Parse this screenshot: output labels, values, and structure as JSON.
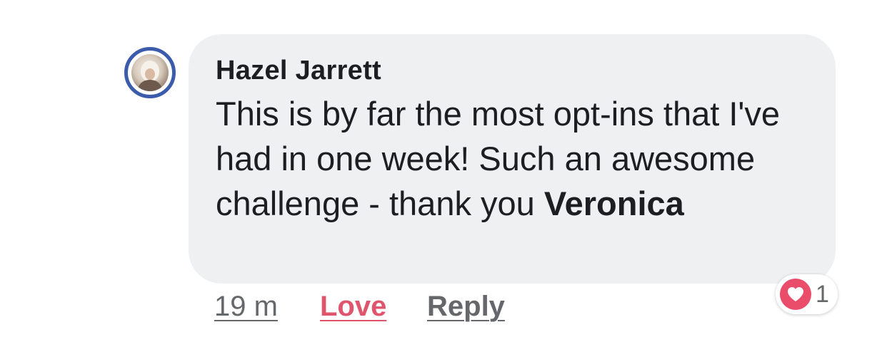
{
  "comment": {
    "author": "Hazel Jarrett",
    "text_before_mention": "This is by far the most opt-ins that I've had in one week! Such an awesome challenge - thank you ",
    "mention": "Veronica"
  },
  "actions": {
    "time": "19 m",
    "love_label": "Love",
    "reply_label": "Reply"
  },
  "reactions": {
    "icon": "heart-icon",
    "count": "1"
  },
  "colors": {
    "bubble": "#eff0f2",
    "love": "#e0556e",
    "avatar_ring": "#3b5bab",
    "muted_text": "#65676b"
  }
}
